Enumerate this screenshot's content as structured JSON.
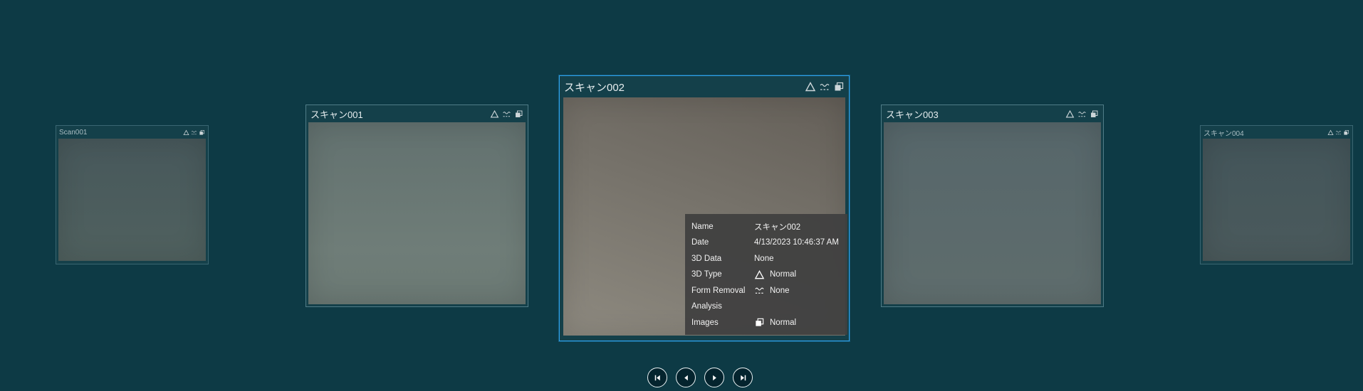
{
  "app": {
    "background_color": "#0d3a45",
    "accent_color": "#2da0e8",
    "tooltip_background": "#404040"
  },
  "carousel": {
    "cards": [
      {
        "name": "Scan001",
        "selected": false,
        "size": "small"
      },
      {
        "name": "スキャン001",
        "selected": false,
        "size": "medium"
      },
      {
        "name": "スキャン002",
        "selected": true,
        "size": "large"
      },
      {
        "name": "スキャン003",
        "selected": false,
        "size": "medium"
      },
      {
        "name": "スキャン004",
        "selected": false,
        "size": "small"
      }
    ],
    "card_status_icons": [
      "triangle-icon",
      "form-removal-icon",
      "images-icon"
    ]
  },
  "tooltip": {
    "rows": [
      {
        "label": "Name",
        "value": "スキャン002",
        "icon": ""
      },
      {
        "label": "Date",
        "value": "4/13/2023 10:46:37 AM",
        "icon": ""
      },
      {
        "label": "3D Data",
        "value": "None",
        "icon": ""
      },
      {
        "label": "3D Type",
        "value": "Normal",
        "icon": "triangle-icon"
      },
      {
        "label": "Form Removal",
        "value": "None",
        "icon": "form-removal-icon"
      },
      {
        "label": "Analysis",
        "value": "",
        "icon": ""
      },
      {
        "label": "Images",
        "value": "Normal",
        "icon": "images-icon"
      }
    ]
  },
  "nav": {
    "buttons": [
      {
        "name": "First"
      },
      {
        "name": "Previous"
      },
      {
        "name": "Next"
      },
      {
        "name": "Last"
      }
    ]
  }
}
